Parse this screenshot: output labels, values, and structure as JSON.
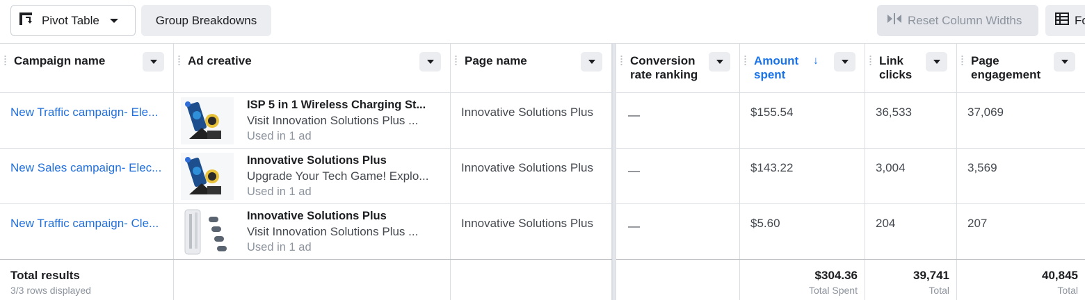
{
  "toolbar": {
    "pivot_label": "Pivot Table",
    "group_label": "Group Breakdowns",
    "reset_label": "Reset Column Widths",
    "format_label": "Fo"
  },
  "columns": {
    "campaign": "Campaign name",
    "ad_creative": "Ad creative",
    "page_name": "Page name",
    "conversion_1": "Conversion",
    "conversion_2": "rate ranking",
    "amount_1": "Amount",
    "amount_2": "spent",
    "link_1": "Link",
    "link_2": "clicks",
    "engagement_1": "Page",
    "engagement_2": "engagement"
  },
  "rows": [
    {
      "campaign": "New Traffic campaign- Ele...",
      "ad_title": "ISP 5 in 1 Wireless Charging St...",
      "ad_sub": "Visit Innovation Solutions Plus ...",
      "ad_used": "Used in 1 ad",
      "page_name": "Innovative Solutions Plus",
      "conversion": "—",
      "amount": "$155.54",
      "link_clicks": "36,533",
      "engagement": "37,069"
    },
    {
      "campaign": "New Sales campaign- Elec...",
      "ad_title": "Innovative Solutions Plus",
      "ad_sub": "Upgrade Your Tech Game! Explo...",
      "ad_used": "Used in 1 ad",
      "page_name": "Innovative Solutions Plus",
      "conversion": "—",
      "amount": "$143.22",
      "link_clicks": "3,004",
      "engagement": "3,569"
    },
    {
      "campaign": "New Traffic campaign- Cle...",
      "ad_title": "Innovative Solutions Plus",
      "ad_sub": "Visit Innovation Solutions Plus ...",
      "ad_used": "Used in 1 ad",
      "page_name": "Innovative Solutions Plus",
      "conversion": "—",
      "amount": "$5.60",
      "link_clicks": "204",
      "engagement": "207"
    }
  ],
  "totals": {
    "title": "Total results",
    "subtitle": "3/3 rows displayed",
    "amount": "$304.36",
    "amount_label": "Total Spent",
    "link_clicks": "39,741",
    "link_label": "Total",
    "engagement": "40,845",
    "engagement_label": "Total"
  },
  "colors": {
    "link_blue": "#216fdb",
    "sort_blue": "#1a73e8"
  }
}
